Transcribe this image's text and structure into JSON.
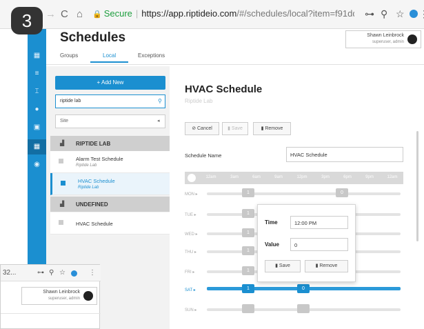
{
  "step_badge": "3",
  "browser": {
    "back": "←",
    "forward": "→",
    "reload": "C",
    "home": "⌂",
    "lock": "🔒",
    "secure_label": "Secure",
    "url_host": "https://app.riptideio.com",
    "url_rest": "/#/schedules/local?item=f91dd32...",
    "key_icon": "⊶",
    "zoom_icon": "⚲",
    "star_icon": "☆",
    "menu_icon": "⋮"
  },
  "rail": {
    "items": [
      "▦",
      "≡",
      "⌶",
      "●",
      "▣",
      "▦",
      "◉"
    ]
  },
  "header": {
    "title": "Schedules",
    "user_name": "Shawn Leinbrock",
    "user_role": "superuser, admin"
  },
  "tabs": [
    "Groups",
    "Local",
    "Exceptions"
  ],
  "sidebar": {
    "add_label": "+ Add New",
    "search_value": "riptide lab",
    "search_icon": "⚲",
    "site_placeholder": "Site",
    "site_arrow": "◂",
    "groups": [
      {
        "label": "RIPTIDE LAB",
        "icon": "▟"
      },
      {
        "label": "UNDEFINED",
        "icon": "▟"
      }
    ],
    "schedules": [
      {
        "name": "Alarm Test Schedule",
        "site": "Riptide Lab"
      },
      {
        "name": "HVAC Schedule",
        "site": "Riptide Lab"
      },
      {
        "name": "HVAC Schedule"
      }
    ]
  },
  "detail": {
    "title": "HVAC Schedule",
    "subtitle": "Riptide Lab",
    "cancel_label": "⊘ Cancel",
    "save_label": "▮ Save",
    "remove_label": "▮ Remove",
    "schedule_name_label": "Schedule Name",
    "schedule_name_value": "HVAC Schedule",
    "time_ticks": [
      "12am",
      "3am",
      "6am",
      "9am",
      "12pm",
      "3pm",
      "6pm",
      "9pm",
      "12am"
    ],
    "days": [
      {
        "label": "MON ▸",
        "knobs": [
          "1",
          "0"
        ]
      },
      {
        "label": "TUE ▸",
        "knobs": [
          "1"
        ]
      },
      {
        "label": "WED ▸",
        "knobs": [
          "1"
        ]
      },
      {
        "label": "THU ▸",
        "knobs": [
          "1"
        ]
      },
      {
        "label": "FRI ▸",
        "knobs": [
          "1"
        ]
      },
      {
        "label": "SAT ▸",
        "knobs": [
          "1",
          "0"
        ]
      },
      {
        "label": "SUN ▸",
        "knobs": [
          "",
          ""
        ]
      }
    ]
  },
  "popover": {
    "time_label": "Time",
    "time_value": "12:00 PM",
    "value_label": "Value",
    "value_value": "0",
    "save_label": "▮ Save",
    "remove_label": "▮ Remove"
  },
  "overlay": {
    "url_fragment": "32...",
    "user_name": "Shawn Leinbrock",
    "user_role": "superuser, admin"
  }
}
